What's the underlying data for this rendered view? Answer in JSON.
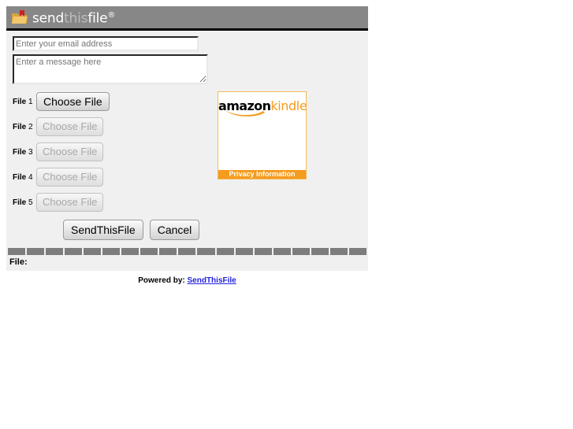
{
  "header": {
    "logo_icon": "folder-flag-icon",
    "brand_part1": "send",
    "brand_part2": "this",
    "brand_part3": "file",
    "brand_trademark": "®",
    "bar_color": "#878787"
  },
  "form": {
    "email": {
      "value": "",
      "placeholder": "Enter your email address"
    },
    "message": {
      "value": "",
      "placeholder": "Enter a message here"
    },
    "files": [
      {
        "label_bold": "File",
        "label_num": "1",
        "button": "Choose File",
        "enabled": true
      },
      {
        "label_bold": "File",
        "label_num": "2",
        "button": "Choose File",
        "enabled": false
      },
      {
        "label_bold": "File",
        "label_num": "3",
        "button": "Choose File",
        "enabled": false
      },
      {
        "label_bold": "File",
        "label_num": "4",
        "button": "Choose File",
        "enabled": false
      },
      {
        "label_bold": "File",
        "label_num": "5",
        "button": "Choose File",
        "enabled": false
      }
    ]
  },
  "ad": {
    "brand_black": "amazon",
    "brand_orange": "kindle",
    "privacy_label": "Privacy Information",
    "accent_color": "#f59b1e",
    "border_color": "#f5b95a"
  },
  "actions": {
    "submit_label": "SendThisFile",
    "cancel_label": "Cancel"
  },
  "progress": {
    "segments": 19,
    "filled": 0,
    "segment_color": "#7d7d7d"
  },
  "status": {
    "file_label": "File:",
    "file_value": ""
  },
  "footer": {
    "prefix": "Powered by:",
    "link_label": "SendThisFile"
  }
}
